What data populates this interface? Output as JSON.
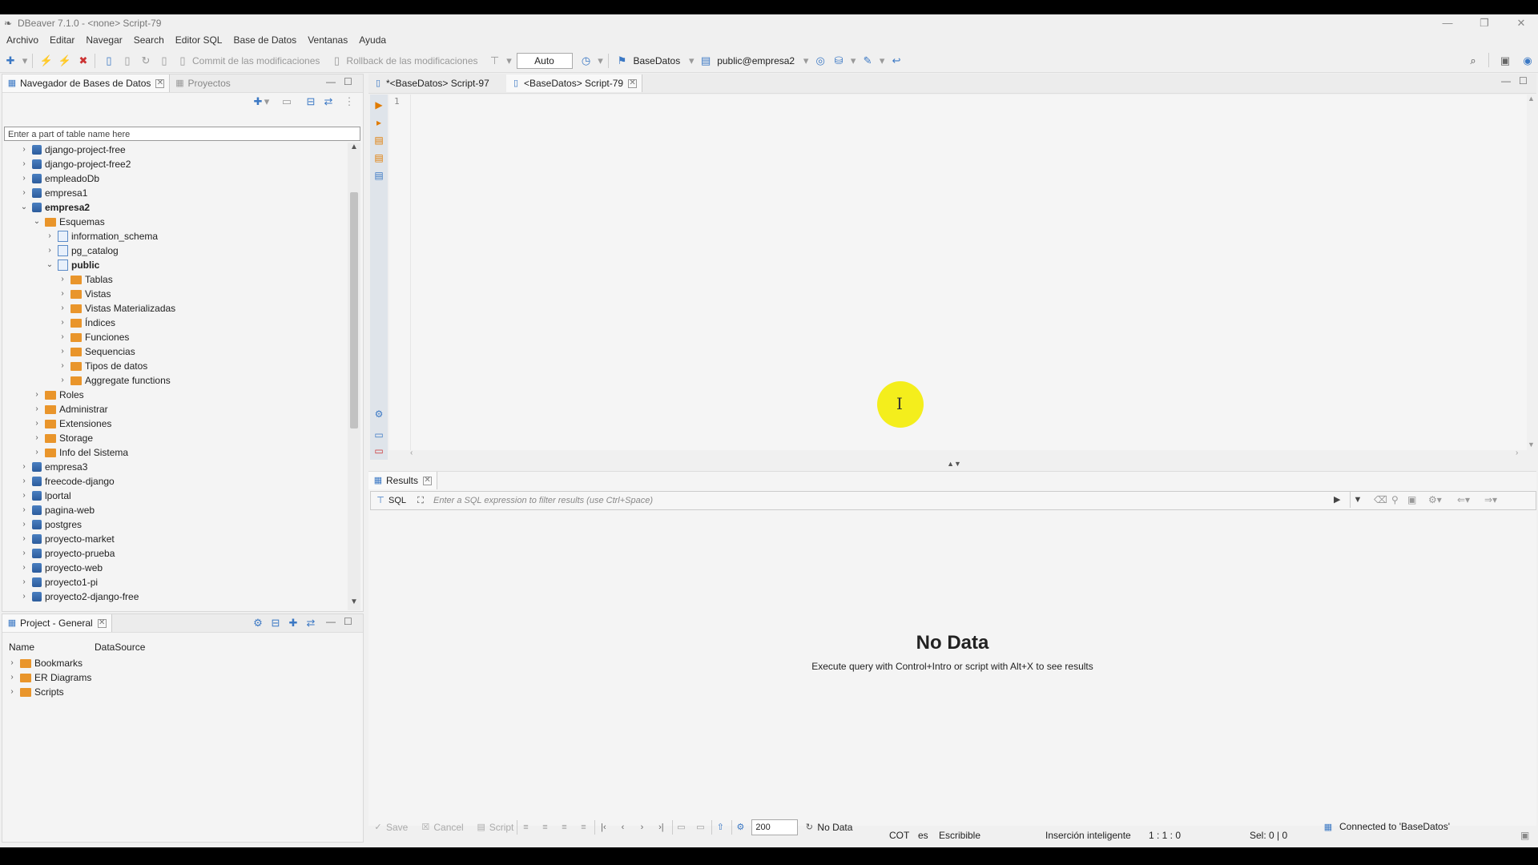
{
  "window": {
    "title": "DBeaver 7.1.0 - <none> Script-79",
    "minimize": "—",
    "maximize": "❐",
    "close": "✕"
  },
  "menu": [
    "Archivo",
    "Editar",
    "Navegar",
    "Search",
    "Editor SQL",
    "Base de Datos",
    "Ventanas",
    "Ayuda"
  ],
  "toolbar": {
    "commit_label": "Commit de las modificaciones",
    "rollback_label": "Rollback de las modificaciones",
    "transaction_mode": "Auto",
    "datasource": "BaseDatos",
    "schema": "public@empresa2"
  },
  "navigator": {
    "tab_label": "Navegador de Bases de Datos",
    "projects_tab_label": "Proyectos",
    "filter_placeholder": "Enter a part of table name here",
    "items": [
      {
        "label": "django-project-free",
        "level": 0,
        "type": "db",
        "expanded": false
      },
      {
        "label": "django-project-free2",
        "level": 0,
        "type": "db",
        "expanded": false
      },
      {
        "label": "empleadoDb",
        "level": 0,
        "type": "db",
        "expanded": false
      },
      {
        "label": "empresa1",
        "level": 0,
        "type": "db",
        "expanded": false
      },
      {
        "label": "empresa2",
        "level": 0,
        "type": "db",
        "expanded": true,
        "bold": true
      },
      {
        "label": "Esquemas",
        "level": 1,
        "type": "folder",
        "expanded": true
      },
      {
        "label": "information_schema",
        "level": 2,
        "type": "schema",
        "expanded": false
      },
      {
        "label": "pg_catalog",
        "level": 2,
        "type": "schema",
        "expanded": false
      },
      {
        "label": "public",
        "level": 2,
        "type": "schema",
        "expanded": true,
        "bold": true
      },
      {
        "label": "Tablas",
        "level": 3,
        "type": "folder",
        "expanded": false
      },
      {
        "label": "Vistas",
        "level": 3,
        "type": "folder",
        "expanded": false
      },
      {
        "label": "Vistas Materializadas",
        "level": 3,
        "type": "folder",
        "expanded": false
      },
      {
        "label": "Índices",
        "level": 3,
        "type": "folder",
        "expanded": false
      },
      {
        "label": "Funciones",
        "level": 3,
        "type": "folder",
        "expanded": false
      },
      {
        "label": "Sequencias",
        "level": 3,
        "type": "folder",
        "expanded": false
      },
      {
        "label": "Tipos de datos",
        "level": 3,
        "type": "folder",
        "expanded": false
      },
      {
        "label": "Aggregate functions",
        "level": 3,
        "type": "folder",
        "expanded": false
      },
      {
        "label": "Roles",
        "level": 1,
        "type": "folder",
        "expanded": false
      },
      {
        "label": "Administrar",
        "level": 1,
        "type": "folder",
        "expanded": false
      },
      {
        "label": "Extensiones",
        "level": 1,
        "type": "folder",
        "expanded": false
      },
      {
        "label": "Storage",
        "level": 1,
        "type": "folder",
        "expanded": false
      },
      {
        "label": "Info del Sistema",
        "level": 1,
        "type": "folder",
        "expanded": false
      },
      {
        "label": "empresa3",
        "level": 0,
        "type": "db",
        "expanded": false
      },
      {
        "label": "freecode-django",
        "level": 0,
        "type": "db",
        "expanded": false
      },
      {
        "label": "lportal",
        "level": 0,
        "type": "db",
        "expanded": false
      },
      {
        "label": "pagina-web",
        "level": 0,
        "type": "db",
        "expanded": false
      },
      {
        "label": "postgres",
        "level": 0,
        "type": "db",
        "expanded": false
      },
      {
        "label": "proyecto-market",
        "level": 0,
        "type": "db",
        "expanded": false
      },
      {
        "label": "proyecto-prueba",
        "level": 0,
        "type": "db",
        "expanded": false
      },
      {
        "label": "proyecto-web",
        "level": 0,
        "type": "db",
        "expanded": false
      },
      {
        "label": "proyecto1-pi",
        "level": 0,
        "type": "db",
        "expanded": false
      },
      {
        "label": "proyecto2-django-free",
        "level": 0,
        "type": "db",
        "expanded": false
      }
    ]
  },
  "project": {
    "tab_label": "Project - General",
    "columns": [
      "Name",
      "DataSource"
    ],
    "items": [
      "Bookmarks",
      "ER Diagrams",
      "Scripts"
    ]
  },
  "editor": {
    "tabs": [
      "*<BaseDatos> Script-97",
      "<BaseDatos> Script-79"
    ],
    "active_tab": 1,
    "line_number": "1"
  },
  "results": {
    "tab_label": "Results",
    "sql_label": "SQL",
    "filter_placeholder": "Enter a SQL expression to filter results (use Ctrl+Space)",
    "nodata_title": "No Data",
    "nodata_message": "Execute query with Control+Intro or script with Alt+X to see results",
    "save_label": "Save",
    "cancel_label": "Cancel",
    "script_label": "Script",
    "fetch_size": "200",
    "status": "No Data",
    "connection": "Connected to 'BaseDatos'"
  },
  "statusbar": {
    "timezone": "COT",
    "locale": "es",
    "mode": "Escribible",
    "insert_mode": "Inserción inteligente",
    "position": "1 : 1 : 0",
    "selection": "Sel: 0 | 0"
  }
}
